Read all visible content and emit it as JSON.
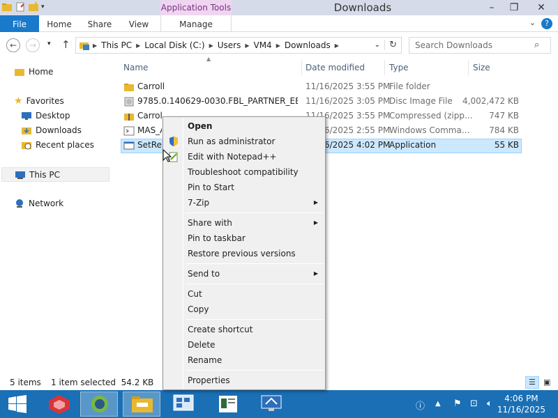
{
  "window": {
    "title": "Downloads",
    "contextual_tab_group": "Application Tools",
    "controls": {
      "minimize": "–",
      "maximize": "❐",
      "close": "✕"
    }
  },
  "ribbon": {
    "tabs": [
      "File",
      "Home",
      "Share",
      "View",
      "Manage"
    ],
    "help": "?"
  },
  "address": {
    "crumbs": [
      "This PC",
      "Local Disk (C:)",
      "Users",
      "VM4",
      "Downloads"
    ],
    "search_placeholder": "Search Downloads"
  },
  "navpane": {
    "items": [
      "Home",
      "Favorites",
      "Desktop",
      "Downloads",
      "Recent places",
      "This PC",
      "Network"
    ]
  },
  "columns": [
    "Name",
    "Date modified",
    "Type",
    "Size"
  ],
  "files": [
    {
      "name": "Carroll",
      "date": "11/16/2025 3:55 PM",
      "type": "File folder",
      "size": "",
      "icon": "folder-icon"
    },
    {
      "name": "9785.0.140629-0030.FBL_PARTNER_EEAP_...",
      "date": "11/16/2025 3:05 PM",
      "type": "Disc Image File",
      "size": "4,002,472 KB",
      "icon": "disc-image-icon"
    },
    {
      "name": "Carroll",
      "date": "11/16/2025 3:55 PM",
      "type": "Compressed (zipp...",
      "size": "747 KB",
      "icon": "zip-folder-icon"
    },
    {
      "name": "MAS_A",
      "date": "11/16/2025 2:55 PM",
      "type": "Windows Comma...",
      "size": "784 KB",
      "icon": "cmd-script-icon"
    },
    {
      "name": "SetRes",
      "date": "11/16/2025 4:02 PM",
      "type": "Application",
      "size": "55 KB",
      "icon": "application-icon"
    }
  ],
  "status": {
    "items_count": "5 items",
    "selection": "1 item selected  54.2 KB"
  },
  "context_menu": {
    "items": [
      {
        "label": "Open",
        "bold": true
      },
      {
        "label": "Run as administrator",
        "icon": "uac-shield-icon"
      },
      {
        "label": "Edit with Notepad++",
        "icon": "notepadpp-icon"
      },
      {
        "label": "Troubleshoot compatibility"
      },
      {
        "label": "Pin to Start"
      },
      {
        "label": "7-Zip",
        "submenu": true
      },
      {
        "label": "Share with",
        "submenu": true
      },
      {
        "label": "Pin to taskbar"
      },
      {
        "label": "Restore previous versions"
      },
      {
        "label": "Send to",
        "submenu": true
      },
      {
        "label": "Cut"
      },
      {
        "label": "Copy"
      },
      {
        "label": "Create shortcut"
      },
      {
        "label": "Delete"
      },
      {
        "label": "Rename"
      },
      {
        "label": "Properties"
      }
    ]
  },
  "taskbar": {
    "clock_time": "4:06 PM",
    "clock_date": "11/16/2025"
  },
  "colors": {
    "accent": "#1979ca",
    "taskbar": "#1a6fb5",
    "selection": "#cce8ff",
    "contextual_tab": "#efd6f0"
  }
}
